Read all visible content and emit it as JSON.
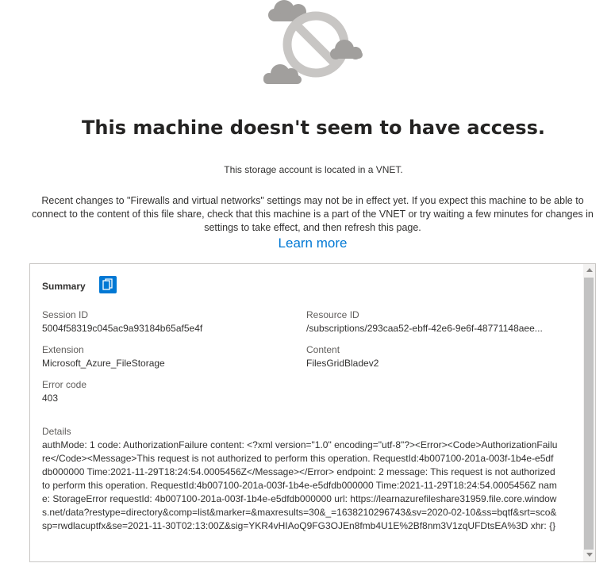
{
  "illustration": {
    "icon": "no-access-cloud-icon"
  },
  "title": "This machine doesn't seem to have access.",
  "vnet_message": "This storage account is located in a VNET.",
  "description": "Recent changes to \"Firewalls and virtual networks\" settings may not be in effect yet. If you expect this machine to be able to connect to the content of this file share, check that this machine is a part of the VNET or try waiting a few minutes for changes in settings to take effect, and then refresh this page.",
  "learn_more": "Learn more",
  "summary": {
    "heading": "Summary",
    "copy_icon": "copy-icon",
    "session_id_label": "Session ID",
    "session_id": "5004f58319c045ac9a93184b65af5e4f",
    "resource_id_label": "Resource ID",
    "resource_id": "/subscriptions/293caa52-ebff-42e6-9e6f-48771148aee...",
    "extension_label": "Extension",
    "extension": "Microsoft_Azure_FileStorage",
    "content_label": "Content",
    "content": "FilesGridBladev2",
    "error_code_label": "Error code",
    "error_code": "403",
    "details_label": "Details",
    "details": "authMode: 1 code: AuthorizationFailure content: <?xml version=\"1.0\" encoding=\"utf-8\"?><Error><Code>AuthorizationFailure</Code><Message>This request is not authorized to perform this operation. RequestId:4b007100-201a-003f-1b4e-e5dfdb000000 Time:2021-11-29T18:24:54.0005456Z</Message></Error> endpoint: 2 message: This request is not authorized to perform this operation. RequestId:4b007100-201a-003f-1b4e-e5dfdb000000 Time:2021-11-29T18:24:54.0005456Z name: StorageError requestId: 4b007100-201a-003f-1b4e-e5dfdb000000 url: https://learnazurefileshare31959.file.core.windows.net/data?restype=directory&comp=list&marker=&maxresults=30&_=1638210296743&sv=2020-02-10&ss=bqtf&srt=sco&sp=rwdlacuptfx&se=2021-11-30T02:13:00Z&sig=YKR4vHIAoQ9FG3OJEn8fmb4U1E%2Bf8nm3V1zqUFDtsEA%3D xhr: {}"
  },
  "colors": {
    "accent": "#0078d4",
    "text": "#323130",
    "cloud": "#a19f9d",
    "border": "#c8c6c4"
  }
}
